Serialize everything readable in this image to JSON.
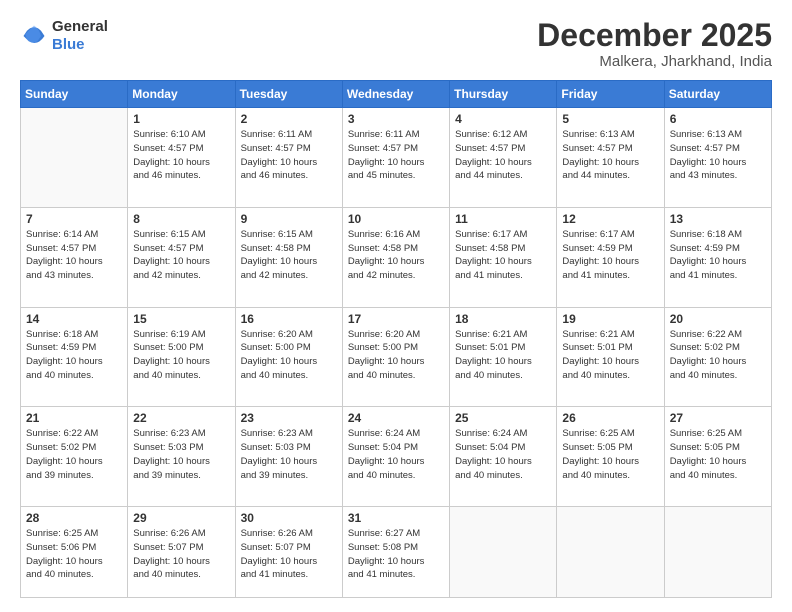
{
  "header": {
    "logo_line1": "General",
    "logo_line2": "Blue",
    "month": "December 2025",
    "location": "Malkera, Jharkhand, India"
  },
  "weekdays": [
    "Sunday",
    "Monday",
    "Tuesday",
    "Wednesday",
    "Thursday",
    "Friday",
    "Saturday"
  ],
  "weeks": [
    [
      {
        "day": "",
        "info": ""
      },
      {
        "day": "1",
        "info": "Sunrise: 6:10 AM\nSunset: 4:57 PM\nDaylight: 10 hours\nand 46 minutes."
      },
      {
        "day": "2",
        "info": "Sunrise: 6:11 AM\nSunset: 4:57 PM\nDaylight: 10 hours\nand 46 minutes."
      },
      {
        "day": "3",
        "info": "Sunrise: 6:11 AM\nSunset: 4:57 PM\nDaylight: 10 hours\nand 45 minutes."
      },
      {
        "day": "4",
        "info": "Sunrise: 6:12 AM\nSunset: 4:57 PM\nDaylight: 10 hours\nand 44 minutes."
      },
      {
        "day": "5",
        "info": "Sunrise: 6:13 AM\nSunset: 4:57 PM\nDaylight: 10 hours\nand 44 minutes."
      },
      {
        "day": "6",
        "info": "Sunrise: 6:13 AM\nSunset: 4:57 PM\nDaylight: 10 hours\nand 43 minutes."
      }
    ],
    [
      {
        "day": "7",
        "info": "Sunrise: 6:14 AM\nSunset: 4:57 PM\nDaylight: 10 hours\nand 43 minutes."
      },
      {
        "day": "8",
        "info": "Sunrise: 6:15 AM\nSunset: 4:57 PM\nDaylight: 10 hours\nand 42 minutes."
      },
      {
        "day": "9",
        "info": "Sunrise: 6:15 AM\nSunset: 4:58 PM\nDaylight: 10 hours\nand 42 minutes."
      },
      {
        "day": "10",
        "info": "Sunrise: 6:16 AM\nSunset: 4:58 PM\nDaylight: 10 hours\nand 42 minutes."
      },
      {
        "day": "11",
        "info": "Sunrise: 6:17 AM\nSunset: 4:58 PM\nDaylight: 10 hours\nand 41 minutes."
      },
      {
        "day": "12",
        "info": "Sunrise: 6:17 AM\nSunset: 4:59 PM\nDaylight: 10 hours\nand 41 minutes."
      },
      {
        "day": "13",
        "info": "Sunrise: 6:18 AM\nSunset: 4:59 PM\nDaylight: 10 hours\nand 41 minutes."
      }
    ],
    [
      {
        "day": "14",
        "info": "Sunrise: 6:18 AM\nSunset: 4:59 PM\nDaylight: 10 hours\nand 40 minutes."
      },
      {
        "day": "15",
        "info": "Sunrise: 6:19 AM\nSunset: 5:00 PM\nDaylight: 10 hours\nand 40 minutes."
      },
      {
        "day": "16",
        "info": "Sunrise: 6:20 AM\nSunset: 5:00 PM\nDaylight: 10 hours\nand 40 minutes."
      },
      {
        "day": "17",
        "info": "Sunrise: 6:20 AM\nSunset: 5:00 PM\nDaylight: 10 hours\nand 40 minutes."
      },
      {
        "day": "18",
        "info": "Sunrise: 6:21 AM\nSunset: 5:01 PM\nDaylight: 10 hours\nand 40 minutes."
      },
      {
        "day": "19",
        "info": "Sunrise: 6:21 AM\nSunset: 5:01 PM\nDaylight: 10 hours\nand 40 minutes."
      },
      {
        "day": "20",
        "info": "Sunrise: 6:22 AM\nSunset: 5:02 PM\nDaylight: 10 hours\nand 40 minutes."
      }
    ],
    [
      {
        "day": "21",
        "info": "Sunrise: 6:22 AM\nSunset: 5:02 PM\nDaylight: 10 hours\nand 39 minutes."
      },
      {
        "day": "22",
        "info": "Sunrise: 6:23 AM\nSunset: 5:03 PM\nDaylight: 10 hours\nand 39 minutes."
      },
      {
        "day": "23",
        "info": "Sunrise: 6:23 AM\nSunset: 5:03 PM\nDaylight: 10 hours\nand 39 minutes."
      },
      {
        "day": "24",
        "info": "Sunrise: 6:24 AM\nSunset: 5:04 PM\nDaylight: 10 hours\nand 40 minutes."
      },
      {
        "day": "25",
        "info": "Sunrise: 6:24 AM\nSunset: 5:04 PM\nDaylight: 10 hours\nand 40 minutes."
      },
      {
        "day": "26",
        "info": "Sunrise: 6:25 AM\nSunset: 5:05 PM\nDaylight: 10 hours\nand 40 minutes."
      },
      {
        "day": "27",
        "info": "Sunrise: 6:25 AM\nSunset: 5:05 PM\nDaylight: 10 hours\nand 40 minutes."
      }
    ],
    [
      {
        "day": "28",
        "info": "Sunrise: 6:25 AM\nSunset: 5:06 PM\nDaylight: 10 hours\nand 40 minutes."
      },
      {
        "day": "29",
        "info": "Sunrise: 6:26 AM\nSunset: 5:07 PM\nDaylight: 10 hours\nand 40 minutes."
      },
      {
        "day": "30",
        "info": "Sunrise: 6:26 AM\nSunset: 5:07 PM\nDaylight: 10 hours\nand 41 minutes."
      },
      {
        "day": "31",
        "info": "Sunrise: 6:27 AM\nSunset: 5:08 PM\nDaylight: 10 hours\nand 41 minutes."
      },
      {
        "day": "",
        "info": ""
      },
      {
        "day": "",
        "info": ""
      },
      {
        "day": "",
        "info": ""
      }
    ]
  ]
}
